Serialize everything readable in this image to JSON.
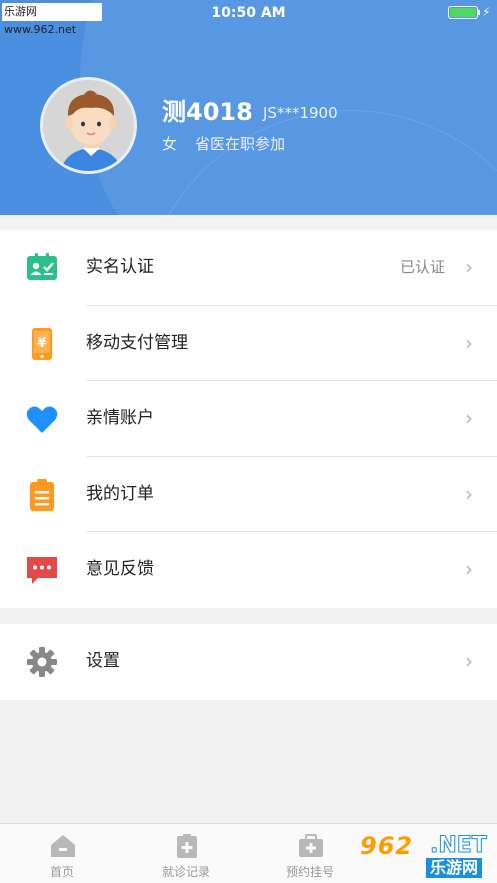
{
  "status_bar": {
    "watermark": "乐游网 www.962.net",
    "time": "10:50 AM"
  },
  "profile": {
    "name": "测4018",
    "id": "JS***1900",
    "gender": "女",
    "organization": "省医在职参加"
  },
  "menu": [
    {
      "label": "实名认证",
      "right": "已认证",
      "icon": "id-card-icon",
      "color": "#2bbf8a"
    },
    {
      "label": "移动支付管理",
      "right": "",
      "icon": "mobile-payment-icon",
      "color": "#ff9a1f"
    },
    {
      "label": "亲情账户",
      "right": "",
      "icon": "heart-icon",
      "color": "#1e90ff"
    },
    {
      "label": "我的订单",
      "right": "",
      "icon": "clipboard-order-icon",
      "color": "#ff9a1f"
    },
    {
      "label": "意见反馈",
      "right": "",
      "icon": "feedback-chat-icon",
      "color": "#e24a4a"
    }
  ],
  "settings": {
    "label": "设置",
    "icon": "gear-icon",
    "color": "#888888"
  },
  "tabbar": {
    "tabs": [
      "首页",
      "就诊记录",
      "预约挂号"
    ],
    "watermark_num": "962",
    "watermark_net": ".NET",
    "watermark_cn": "乐游网"
  },
  "colors": {
    "header": "#4a8fe0",
    "background": "#f2f2f2"
  }
}
